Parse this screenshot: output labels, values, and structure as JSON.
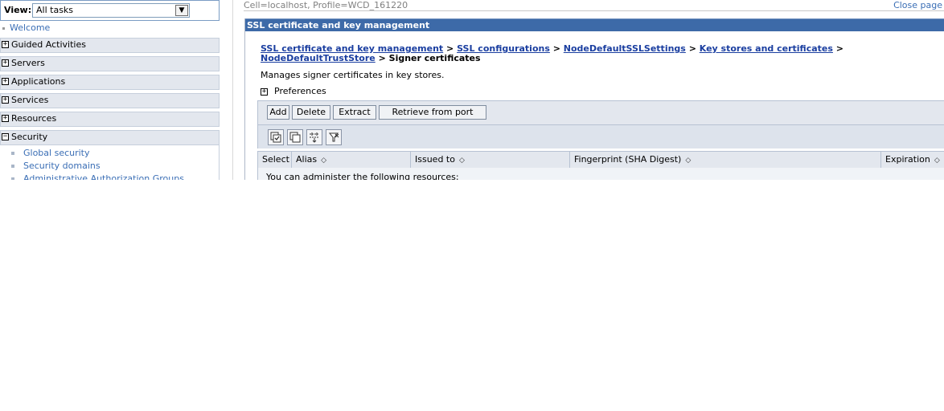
{
  "nav": {
    "view_label": "View:",
    "view_value": "All tasks",
    "welcome": "Welcome",
    "categories": [
      {
        "label": "Guided Activities",
        "state": "+"
      },
      {
        "label": "Servers",
        "state": "+"
      },
      {
        "label": "Applications",
        "state": "+"
      },
      {
        "label": "Services",
        "state": "+"
      },
      {
        "label": "Resources",
        "state": "+"
      },
      {
        "label": "Security",
        "state": "−"
      }
    ],
    "security_items": [
      "Global security",
      "Security domains",
      "Administrative Authorization Groups"
    ]
  },
  "context": {
    "cell_profile": "Cell=localhost, Profile=WCD_161220",
    "close_page": "Close page"
  },
  "panel": {
    "title": "SSL certificate and key management",
    "breadcrumb": {
      "links": [
        "SSL certificate and key management",
        "SSL configurations",
        "NodeDefaultSSLSettings",
        "Key stores and certificates",
        "NodeDefaultTrustStore"
      ],
      "separator": ">",
      "current": "Signer certificates"
    },
    "description": "Manages signer certificates in key stores.",
    "preferences": "Preferences",
    "buttons": {
      "add": "Add",
      "delete": "Delete",
      "extract": "Extract",
      "retrieve": "Retrieve from port"
    },
    "icons": [
      "select-all-icon",
      "deselect-all-icon",
      "show-filter-icon",
      "clear-filter-icon"
    ],
    "table": {
      "columns": [
        "Select",
        "Alias",
        "Issued to",
        "Fingerprint (SHA Digest)",
        "Expiration"
      ],
      "body_text": "You can administer the following resources:"
    }
  },
  "colors": {
    "title_bar": "#3d6aa8",
    "link": "#1a3ea0",
    "nav_link": "#3a6eb5",
    "toolbar_bg": "#e3e7ee"
  }
}
